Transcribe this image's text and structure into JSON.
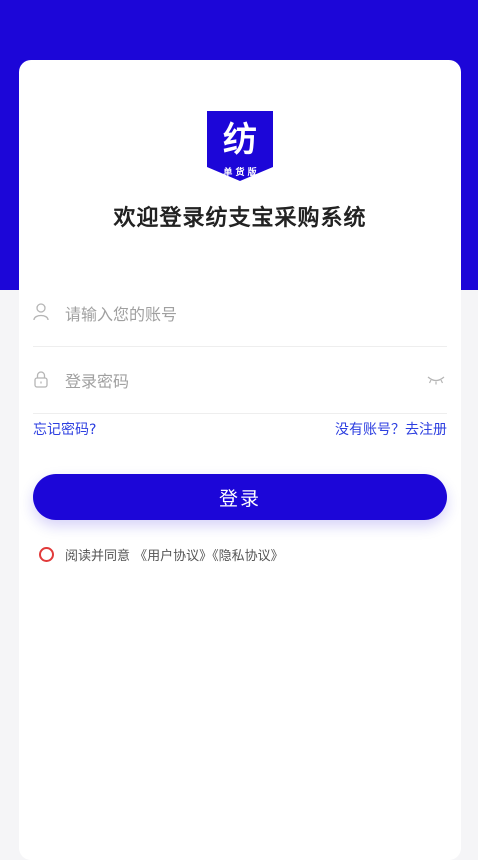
{
  "logo": {
    "icon": "fang-logo-icon",
    "main_char": "纺",
    "sub_text": "单 货 版"
  },
  "title": "欢迎登录纺支宝采购系统",
  "account": {
    "placeholder": "请输入您的账号",
    "icon": "user-icon"
  },
  "password": {
    "placeholder": "登录密码",
    "icon": "lock-icon",
    "toggle_icon": "eye-closed-icon"
  },
  "links": {
    "forgot": "忘记密码?",
    "register": "没有账号？去注册"
  },
  "login_button": "登录",
  "agreement": {
    "prefix": "阅读并同意",
    "user_agreement": "《用户协议》",
    "privacy_agreement": "《隐私协议》"
  },
  "colors": {
    "brand": "#1c06d8",
    "link": "#2d3fe0",
    "radio": "#e13a3a"
  }
}
